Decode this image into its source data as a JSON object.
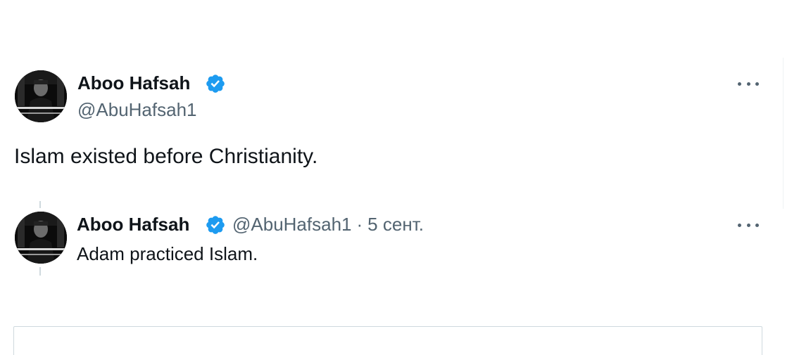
{
  "main_tweet": {
    "author": {
      "display_name": "Aboo Hafsah",
      "handle": "@AbuHafsah1",
      "verified": true,
      "avatar_icon": "avatar-photo"
    },
    "text": "Islam existed before Christianity.",
    "more_icon": "more-horizontal-icon"
  },
  "quoted_tweet": {
    "author": {
      "display_name": "Aboo Hafsah",
      "handle": "@AbuHafsah1",
      "verified": true,
      "avatar_icon": "avatar-photo"
    },
    "separator": "·",
    "date": "5 сент.",
    "text": "Adam practiced Islam.",
    "more_icon": "more-horizontal-icon"
  },
  "colors": {
    "text_primary": "#0f1419",
    "text_secondary": "#536471",
    "verified_blue": "#1d9bf0",
    "border": "#cfd9de"
  }
}
